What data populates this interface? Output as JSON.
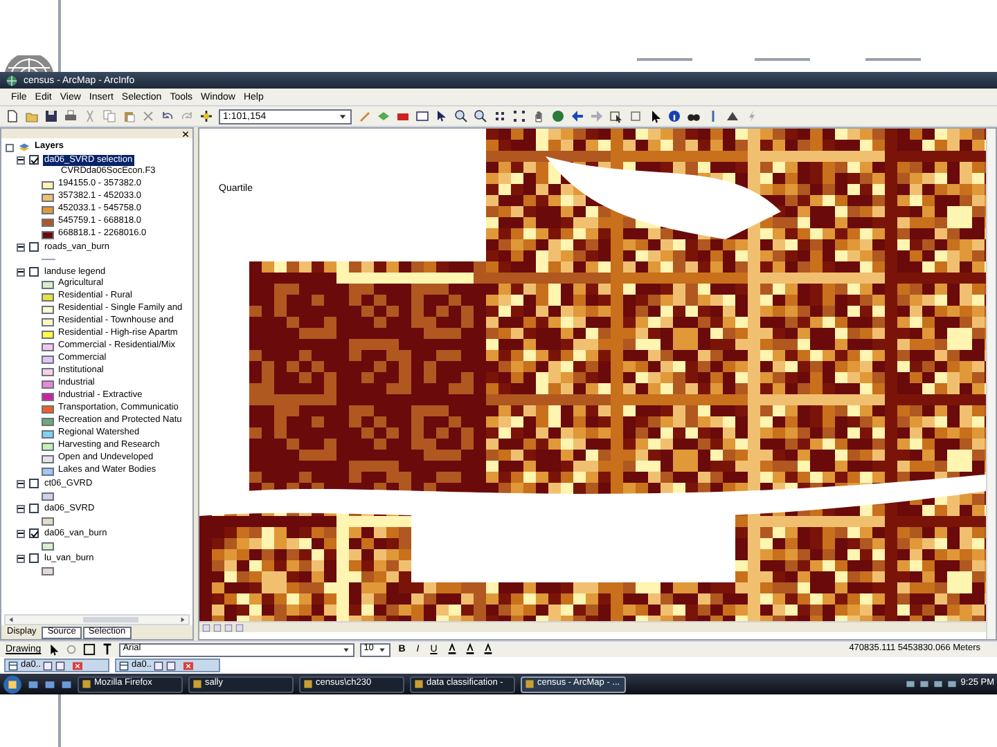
{
  "window": {
    "title": "census - ArcMap - ArcInfo"
  },
  "menu": [
    "File",
    "Edit",
    "View",
    "Insert",
    "Selection",
    "Tools",
    "Window",
    "Help"
  ],
  "toolbar": {
    "scale": "1:101,154"
  },
  "toc": {
    "root": "Layers",
    "layers": [
      {
        "name": "da06_SVRD selection",
        "checked": true,
        "selected": true,
        "expanded": true,
        "field": "CVRDda06SocEcon.F3",
        "items": [
          {
            "label": "194155.0 - 357382.0",
            "color": "#fff4b0"
          },
          {
            "label": "357382.1 - 452033.0",
            "color": "#f0c070"
          },
          {
            "label": "452033.1 - 545758.0",
            "color": "#e09838"
          },
          {
            "label": "545759.1 - 668818.0",
            "color": "#b05820"
          },
          {
            "label": "668818.1 - 2268016.0",
            "color": "#6a0a0a"
          }
        ]
      },
      {
        "name": "roads_van_burn",
        "checked": false,
        "selected": false,
        "expanded": true,
        "kind": "line",
        "items": [
          {
            "color": "#a0a0c0"
          }
        ]
      },
      {
        "name": "landuse legend",
        "checked": false,
        "selected": false,
        "expanded": true,
        "items": [
          {
            "label": "Agricultural",
            "color": "#d8f0c8"
          },
          {
            "label": "Residential - Rural",
            "color": "#e8e040"
          },
          {
            "label": "Residential - Single Family and",
            "color": "#fdfdd0"
          },
          {
            "label": "Residential - Townhouse and",
            "color": "#fff6c0"
          },
          {
            "label": "Residential - High-rise Apartm",
            "color": "#ffff40"
          },
          {
            "label": "Commercial - Residential/Mix",
            "color": "#f4c8e8"
          },
          {
            "label": "Commercial",
            "color": "#e0c8f0"
          },
          {
            "label": "Institutional",
            "color": "#f8d0e0"
          },
          {
            "label": "Industrial",
            "color": "#e888d8"
          },
          {
            "label": "Industrial - Extractive",
            "color": "#d020a0"
          },
          {
            "label": "Transportation, Communicatio",
            "color": "#f06020"
          },
          {
            "label": "Recreation and Protected Natu",
            "color": "#70a870"
          },
          {
            "label": "Regional Watershed",
            "color": "#80d0f0"
          },
          {
            "label": "Harvesting and Research",
            "color": "#c8f0b0"
          },
          {
            "label": "Open and Undeveloped",
            "color": "#e4e4e4"
          },
          {
            "label": "Lakes and Water Bodies",
            "color": "#a0c8f0"
          }
        ]
      },
      {
        "name": "ct06_GVRD",
        "checked": false,
        "selected": false,
        "expanded": true,
        "items": [
          {
            "color": "#d0d0e8"
          }
        ]
      },
      {
        "name": "da06_SVRD",
        "checked": false,
        "selected": false,
        "expanded": true,
        "items": [
          {
            "color": "#e8dcc8"
          }
        ]
      },
      {
        "name": "da06_van_burn",
        "checked": true,
        "selected": false,
        "expanded": true,
        "items": [
          {
            "color": "#d8f0d0"
          }
        ]
      },
      {
        "name": "lu_van_burn",
        "checked": false,
        "selected": false,
        "expanded": true,
        "items": [
          {
            "color": "#e8d8d0"
          }
        ]
      }
    ],
    "tabs": [
      {
        "label": "Display",
        "selected": true
      },
      {
        "label": "Source",
        "selected": false
      },
      {
        "label": "Selection",
        "selected": false
      }
    ]
  },
  "map": {
    "label": "Quartile"
  },
  "drawing_toolbar": {
    "menu": "Drawing",
    "font": "Arial",
    "size": "10",
    "styles": [
      "B",
      "I",
      "U"
    ]
  },
  "minimized": [
    "da0..",
    "da0.."
  ],
  "status_bar": {
    "coordinates": "470835.111  5453830.066 Meters"
  },
  "taskbar": {
    "items": [
      {
        "label": "Mozilla Firefox",
        "selected": false
      },
      {
        "label": "sally",
        "selected": false
      },
      {
        "label": "census\\ch230",
        "selected": false
      },
      {
        "label": "data classification -",
        "selected": false
      },
      {
        "label": "census - ArcMap - ...",
        "selected": true
      }
    ],
    "clock": "9:25 PM"
  }
}
